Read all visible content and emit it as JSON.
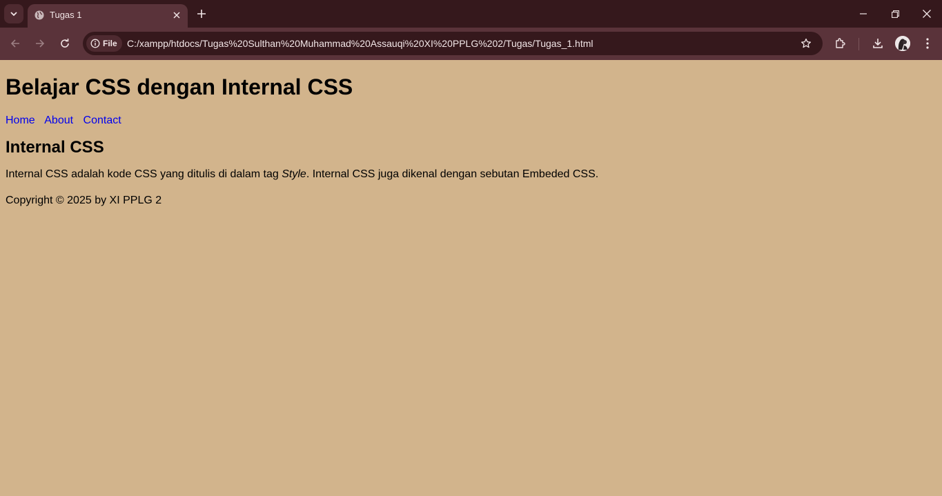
{
  "browser": {
    "tab_title": "Tugas 1",
    "site_chip": "File",
    "url": "C:/xampp/htdocs/Tugas%20Sulthan%20Muhammad%20Assauqi%20XI%20PPLG%202/Tugas/Tugas_1.html",
    "icons": [
      "tab-list-icon",
      "globe-icon",
      "close-icon",
      "plus-icon",
      "minimize-icon",
      "restore-icon",
      "window-close-icon",
      "back-icon",
      "forward-icon",
      "reload-icon",
      "info-icon",
      "star-icon",
      "extensions-icon",
      "download-icon",
      "profile-avatar",
      "more-icon"
    ]
  },
  "page": {
    "heading": "Belajar CSS dengan Internal CSS",
    "nav": [
      {
        "label": "Home"
      },
      {
        "label": "About"
      },
      {
        "label": "Contact"
      }
    ],
    "section_title": "Internal CSS",
    "paragraph_before": "Internal CSS adalah kode CSS yang ditulis di dalam tag ",
    "paragraph_em": "Style",
    "paragraph_after": ". Internal CSS juga dikenal dengan sebutan Embeded CSS.",
    "footer": "Copyright © 2025 by XI PPLG 2"
  },
  "colors": {
    "page_background": "#d2b48c",
    "link": "#0000ee",
    "chrome_dark": "#35181c",
    "chrome_toolbar": "#5a333a"
  }
}
